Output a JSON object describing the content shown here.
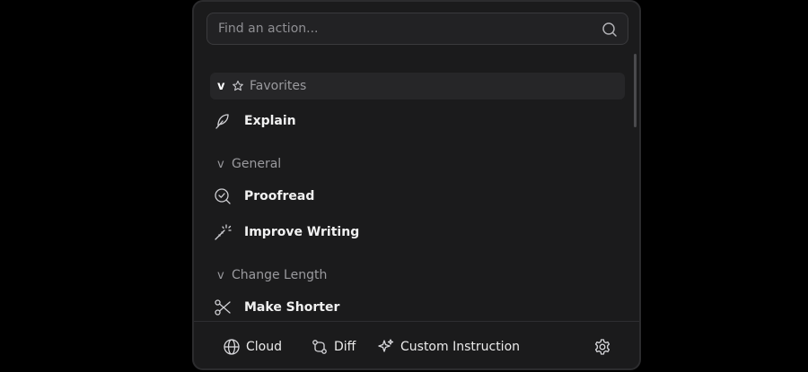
{
  "search": {
    "placeholder": "Find an action..."
  },
  "groups": {
    "favorites": {
      "label": "Favorites",
      "chevron": "v",
      "icon": "star-icon"
    },
    "general": {
      "label": "General",
      "chevron": "v"
    },
    "change_length": {
      "label": "Change Length",
      "chevron": "v"
    }
  },
  "items": {
    "explain": {
      "label": "Explain",
      "icon": "feather-icon"
    },
    "proofread": {
      "label": "Proofread",
      "icon": "search-check-icon"
    },
    "improve_writing": {
      "label": "Improve Writing",
      "icon": "magic-wand-icon"
    },
    "make_shorter": {
      "label": "Make Shorter",
      "icon": "scissors-icon"
    }
  },
  "footer": {
    "cloud": {
      "label": "Cloud",
      "icon": "globe-icon"
    },
    "diff": {
      "label": "Diff",
      "icon": "git-compare-icon"
    },
    "custom": {
      "label": "Custom Instruction",
      "icon": "sparkle-icon"
    },
    "settings": {
      "icon": "gear-icon"
    }
  },
  "colors": {
    "background": "#000000",
    "panel": "#1b1b1c",
    "text": "#ececec",
    "muted": "#9a9a9e"
  }
}
